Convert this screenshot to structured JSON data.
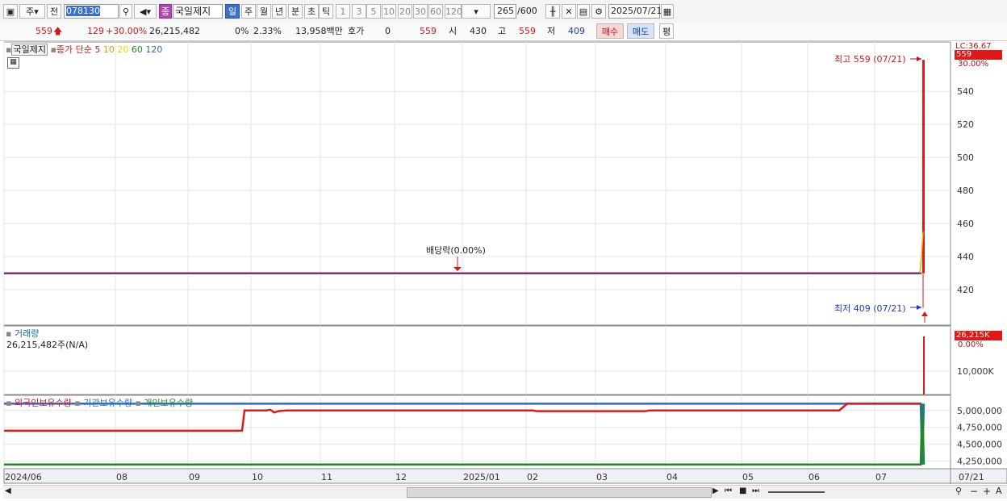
{
  "toolbar": {
    "type_label": "주",
    "prev_label": "전",
    "stock_code": "078130",
    "stock_type_badge": "종",
    "stock_name": "국일제지",
    "periods": [
      "일",
      "주",
      "월",
      "년",
      "분",
      "초",
      "틱"
    ],
    "selected_period": "일",
    "intervals": [
      "1",
      "3",
      "5",
      "10",
      "20",
      "30",
      "60",
      "120"
    ],
    "count_value": "265",
    "count_total": "/600",
    "date": "2025/07/21"
  },
  "quote": {
    "price": "559",
    "change": "129",
    "change_pct": "+30.00%",
    "volume": "26,215,482",
    "ratio1": "0%",
    "ratio2": "2.33%",
    "amount": "13,958백만",
    "hoga_label": "호가",
    "hoga_value": "0",
    "hoga_price": "559",
    "open_label": "시",
    "open_value": "430",
    "high_label": "고",
    "high_value": "559",
    "low_label": "저",
    "low_value": "409",
    "buy_label": "매수",
    "sell_label": "매도",
    "avg_label": "평"
  },
  "price_panel": {
    "legend_name": "국일제지",
    "legend_close": "종가 단순",
    "ma_labels": [
      "5",
      "10",
      "20",
      "60",
      "120"
    ],
    "ma_colors": [
      "#d01818",
      "#e0a000",
      "#e8d800",
      "#208a20",
      "#2a6ad0"
    ],
    "yaxis_top_label": "LC:36.67",
    "price_badge": "559",
    "pct_badge": "30.00%",
    "y_ticks": [
      "540",
      "520",
      "500",
      "480",
      "460",
      "440",
      "420"
    ],
    "high_marker": "최고 559 (07/21)",
    "low_marker": "최저 409 (07/21)",
    "dividend_marker": "배당락(0.00%)"
  },
  "volume_panel": {
    "legend_name": "거래량",
    "value_text": "26,215,482주(N/A)",
    "badge": "26,215K",
    "badge_pct": "0.00%",
    "y_ticks": [
      "10,000K"
    ]
  },
  "holding_panel": {
    "legend": [
      "외국인보유수량",
      "기관보유수량",
      "개인보유수량"
    ],
    "legend_colors": [
      "#d01818",
      "#2a6ad0",
      "#208a20"
    ],
    "y_ticks": [
      "5,000,000",
      "4,750,000",
      "4,500,000",
      "4,250,000"
    ]
  },
  "xaxis": {
    "labels": [
      "2024/06",
      "08",
      "09",
      "10",
      "11",
      "12",
      "2025/01",
      "02",
      "03",
      "04",
      "05",
      "06",
      "07"
    ],
    "last_label": "07/21"
  },
  "chart_data": {
    "type": "line",
    "x": [
      "2024/06",
      "08",
      "09",
      "10",
      "11",
      "12",
      "2025/01",
      "02",
      "03",
      "04",
      "05",
      "06",
      "07",
      "07/21"
    ],
    "series": [
      {
        "name": "종가 단순",
        "values": [
          430,
          430,
          430,
          430,
          430,
          430,
          430,
          430,
          430,
          430,
          430,
          430,
          430,
          559
        ]
      }
    ],
    "ylim": [
      400,
      565
    ],
    "holdings": [
      {
        "name": "외국인보유수량",
        "values": [
          4700000,
          4700000,
          4700000,
          5000000,
          5000000,
          5000000,
          5000000,
          5000000,
          5000000,
          5000000,
          5000000,
          5000000,
          5100000,
          5100000
        ]
      },
      {
        "name": "기관보유수량",
        "values": [
          5100000,
          5100000,
          5100000,
          5100000,
          5100000,
          5100000,
          5100000,
          5100000,
          5100000,
          5100000,
          5100000,
          5100000,
          5100000,
          4200000
        ]
      },
      {
        "name": "개인보유수량",
        "values": [
          4200000,
          4200000,
          4200000,
          4200000,
          4200000,
          4200000,
          4200000,
          4200000,
          4200000,
          4200000,
          4200000,
          4200000,
          4200000,
          4200000
        ]
      }
    ],
    "holdings_ylim": [
      4150000,
      5200000
    ]
  }
}
